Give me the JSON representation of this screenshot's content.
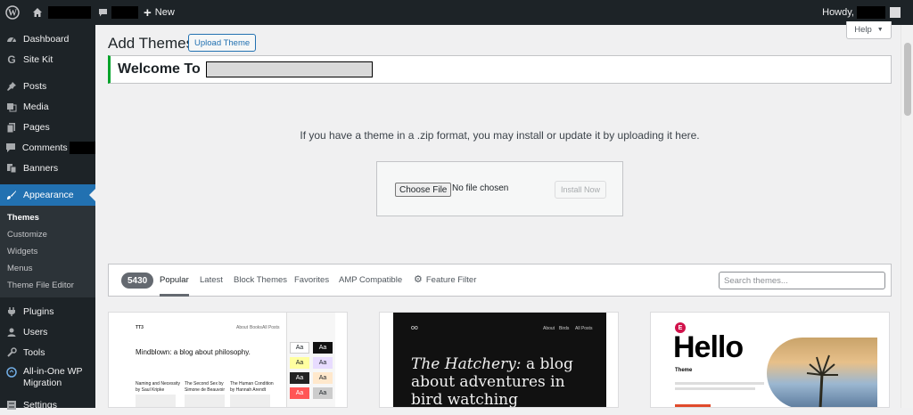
{
  "adminbar": {
    "new_label": "New",
    "howdy_label": "Howdy,"
  },
  "sidebar": {
    "items": [
      {
        "label": "Dashboard"
      },
      {
        "label": "Site Kit"
      },
      {
        "label": "Posts"
      },
      {
        "label": "Media"
      },
      {
        "label": "Pages"
      },
      {
        "label": "Comments"
      },
      {
        "label": "Banners"
      },
      {
        "label": "Appearance"
      },
      {
        "label": "Plugins"
      },
      {
        "label": "Users"
      },
      {
        "label": "Tools"
      },
      {
        "label": "All-in-One WP Migration"
      },
      {
        "label": "Settings"
      }
    ],
    "submenu": [
      "Themes",
      "Customize",
      "Widgets",
      "Menus",
      "Theme File Editor"
    ]
  },
  "header": {
    "title": "Add Themes",
    "upload_button": "Upload Theme",
    "help": "Help"
  },
  "welcome": {
    "title": "Welcome To"
  },
  "upload": {
    "description": "If you have a theme in a .zip format, you may install or update it by uploading it here.",
    "choose_file": "Choose File",
    "no_file": "No file chosen",
    "install_now": "Install Now"
  },
  "filter": {
    "count": "5430",
    "tabs": [
      "Popular",
      "Latest",
      "Block Themes",
      "Favorites",
      "AMP Compatible"
    ],
    "feature_filter": "Feature Filter",
    "search_placeholder": "Search themes..."
  },
  "themes": [
    {
      "headline": "Mindblown: a blog about philosophy.",
      "brand": "TT3",
      "nav": [
        "About",
        "Books",
        "All Posts"
      ],
      "books": [
        {
          "title": "Naming and Necessity",
          "author": "by Saul Kripke"
        },
        {
          "title": "The Second Sex by",
          "author": "Simone de Beauvoir"
        },
        {
          "title": "The Human Condition",
          "author": "by Hannah Arendt"
        }
      ],
      "swatch_label": "Aa"
    },
    {
      "headline_italic": "The Hatchery:",
      "headline_rest": "a blog about adventures in bird watching",
      "nav": [
        "About",
        "Birds",
        "All Posts"
      ],
      "logo": "oo"
    },
    {
      "headline": "Hello",
      "subtitle": "Theme",
      "badge": "E"
    }
  ],
  "colors": {
    "sidebar_bg": "#1d2327",
    "accent": "#2271b1",
    "welcome_border": "#00a32a"
  }
}
